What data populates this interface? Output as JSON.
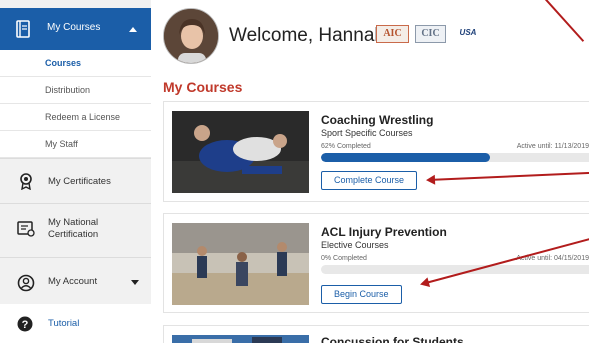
{
  "sidebar": {
    "my_courses": "My Courses",
    "submenu": [
      "Courses",
      "Distribution",
      "Redeem a License",
      "My Staff"
    ],
    "my_certificates": "My Certificates",
    "my_national_certification_line1": "My National",
    "my_national_certification_line2": "Certification",
    "my_account": "My Account",
    "tutorial": "Tutorial"
  },
  "header": {
    "welcome": "Welcome, Hannah",
    "logos": [
      "AIC",
      "CIC",
      "USA"
    ]
  },
  "main": {
    "section_title": "My Courses",
    "courses": [
      {
        "title": "Coaching Wrestling",
        "category": "Sport Specific Courses",
        "progress_text": "62% Completed",
        "progress": 0.62,
        "active_until": "Active until: 11/13/2019",
        "button": "Complete Course"
      },
      {
        "title": "ACL Injury Prevention",
        "category": "Elective Courses",
        "progress_text": "0% Completed",
        "progress": 0,
        "active_until": "Active until: 04/15/2019",
        "button": "Begin Course"
      },
      {
        "title": "Concussion for Students"
      }
    ]
  },
  "colors": {
    "primary": "#1b5ea8",
    "accent_red": "#c0392b",
    "annotation_red": "#b21c1c"
  }
}
